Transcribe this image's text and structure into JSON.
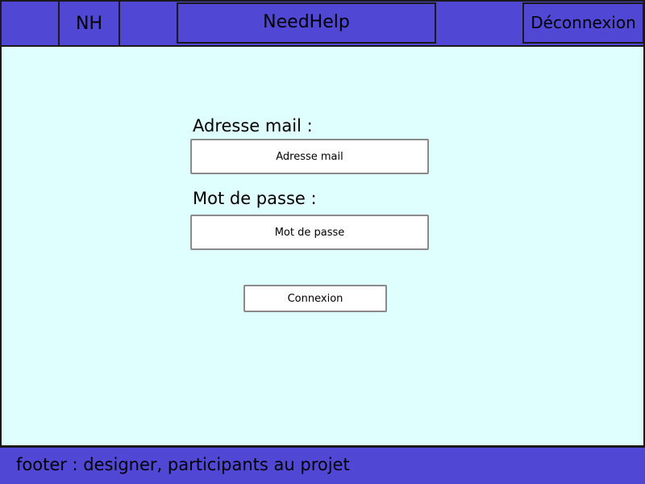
{
  "header": {
    "logo": "NH",
    "title": "NeedHelp",
    "logout_label": "Déconnexion"
  },
  "login_form": {
    "email_label": "Adresse mail :",
    "email_placeholder": "Adresse mail",
    "password_label": "Mot de passe :",
    "password_placeholder": "Mot de passe",
    "submit_label": "Connexion"
  },
  "footer": {
    "text": "footer : designer, participants au projet"
  },
  "colors": {
    "header_bg": "#5047d4",
    "main_bg": "#dfffff",
    "footer_bg": "#5047d4"
  }
}
